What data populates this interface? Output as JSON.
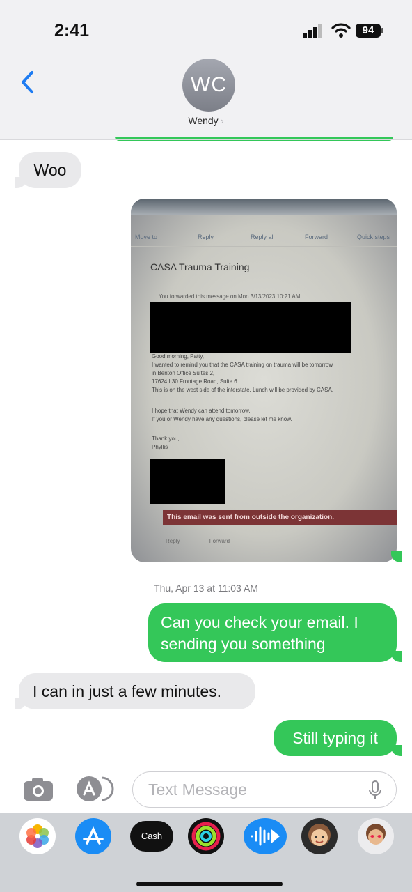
{
  "status_bar": {
    "time": "2:41",
    "battery": "94",
    "icons": [
      "cellular-signal-icon",
      "wifi-icon",
      "battery-icon"
    ]
  },
  "header": {
    "back_icon": "chevron-left-icon",
    "avatar_initials": "WC",
    "contact_name": "Wendy",
    "name_chevron": "chevron-right-icon"
  },
  "messages": [
    {
      "direction": "received",
      "text": "Woo"
    },
    {
      "direction": "sent",
      "type": "photo",
      "photo": {
        "toolbar": [
          "Move to",
          "Reply",
          "Reply all",
          "Forward",
          "Quick steps"
        ],
        "subject": "CASA Trauma Training",
        "forward_note": "You forwarded this message on Mon 3/13/2023 10:21 AM",
        "body_lines": [
          "Good morning, Patty,",
          "I wanted to remind you that the CASA training on trauma will be tomorrow",
          "in Benton Office Suites 2,",
          "17624 I 30 Frontage Road, Suite 6.",
          "This is on the west side of the interstate.  Lunch will be provided by CASA.",
          "",
          "I hope that Wendy can attend tomorrow.",
          "If you or Wendy have any questions, please let me know.",
          "",
          "Thank you,",
          "Phyllis"
        ],
        "warning": "This email was sent from outside the organization.",
        "actions": [
          "Reply",
          "Forward"
        ]
      }
    }
  ],
  "timestamp": "Thu, Apr 13 at 11:03 AM",
  "messages_after": [
    {
      "direction": "sent",
      "text": "Can you check your email. I sending you something"
    },
    {
      "direction": "received",
      "text": "I can in just a few minutes."
    },
    {
      "direction": "sent",
      "text": "Still typing it"
    }
  ],
  "input_bar": {
    "placeholder": "Text Message",
    "icons": [
      "camera-icon",
      "app-store-icon",
      "microphone-icon"
    ]
  },
  "app_drawer": {
    "apps": [
      "photos-icon",
      "app-store-icon",
      "apple-cash-icon",
      "fitness-icon",
      "audio-message-icon",
      "memoji-icon",
      "memoji-stickers-icon"
    ],
    "cash_label": "Cash"
  },
  "colors": {
    "sent_bubble": "#34c759",
    "received_bubble": "#e9e9eb",
    "accent_blue": "#1e7cf2"
  }
}
